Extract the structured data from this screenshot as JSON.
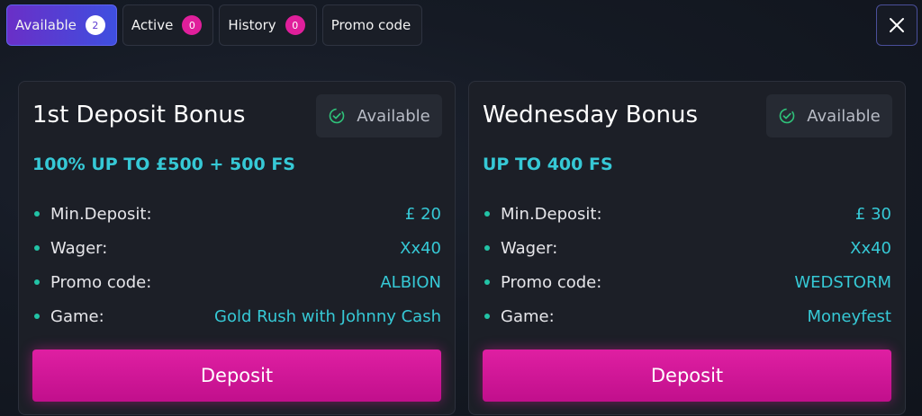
{
  "tabs": [
    {
      "label": "Available",
      "count": "2"
    },
    {
      "label": "Active",
      "count": "0"
    },
    {
      "label": "History",
      "count": "0"
    },
    {
      "label": "Promo code"
    }
  ],
  "colors": {
    "accent": "#e01f9b",
    "highlight": "#36c9d6",
    "bullet": "#22c3a6"
  },
  "cards": [
    {
      "title": "1st Deposit Bonus",
      "status": "Available",
      "subtitle": "100% UP TO £500 + 500 FS",
      "rows": [
        {
          "label": "Min.Deposit:",
          "value": "£ 20"
        },
        {
          "label": "Wager:",
          "value": "Xx40"
        },
        {
          "label": "Promo code:",
          "value": "ALBION"
        },
        {
          "label": "Game:",
          "value": "Gold Rush with Johnny Cash"
        }
      ],
      "button": "Deposit"
    },
    {
      "title": "Wednesday Bonus",
      "status": "Available",
      "subtitle": "UP TO 400 FS",
      "rows": [
        {
          "label": "Min.Deposit:",
          "value": "£ 30"
        },
        {
          "label": "Wager:",
          "value": "Xx40"
        },
        {
          "label": "Promo code:",
          "value": "WEDSTORM"
        },
        {
          "label": "Game:",
          "value": "Moneyfest"
        }
      ],
      "button": "Deposit"
    }
  ]
}
